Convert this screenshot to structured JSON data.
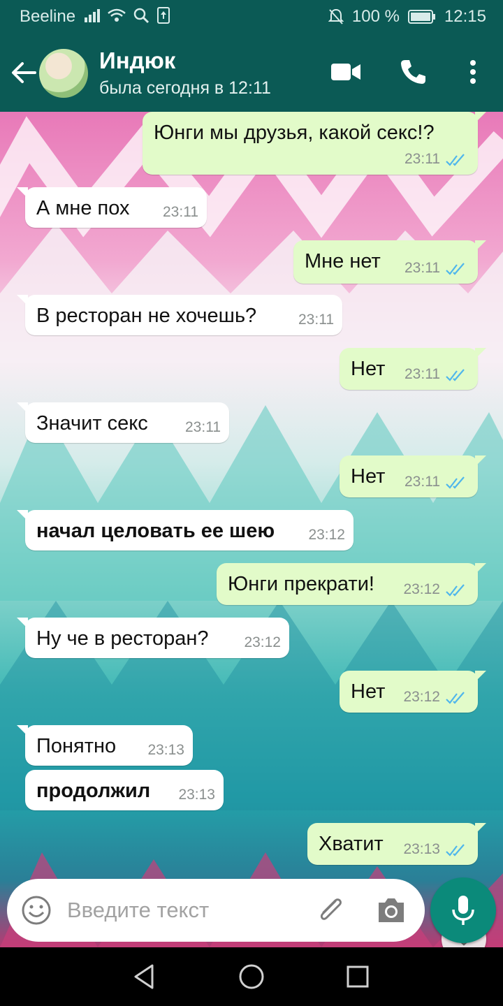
{
  "status_bar": {
    "carrier": "Beeline",
    "battery": "100 %",
    "time": "12:15"
  },
  "header": {
    "contact_name": "Индюк",
    "last_seen": "была сегодня в 12:11"
  },
  "messages": [
    {
      "dir": "out",
      "text": "Юнги мы друзья, какой секс!?",
      "time": "23:11",
      "bold": false
    },
    {
      "dir": "in",
      "text": "А мне пох",
      "time": "23:11",
      "bold": false
    },
    {
      "dir": "out",
      "text": "Мне нет",
      "time": "23:11",
      "bold": false
    },
    {
      "dir": "in",
      "text": "В ресторан не хочешь?",
      "time": "23:11",
      "bold": false
    },
    {
      "dir": "out",
      "text": "Нет",
      "time": "23:11",
      "bold": false
    },
    {
      "dir": "in",
      "text": "Значит секс",
      "time": "23:11",
      "bold": false
    },
    {
      "dir": "out",
      "text": "Нет",
      "time": "23:11",
      "bold": false
    },
    {
      "dir": "in",
      "text": "начал целовать ее шею",
      "time": "23:12",
      "bold": true
    },
    {
      "dir": "out",
      "text": "Юнги прекрати!",
      "time": "23:12",
      "bold": false
    },
    {
      "dir": "in",
      "text": "Ну че в ресторан?",
      "time": "23:12",
      "bold": false
    },
    {
      "dir": "out",
      "text": "Нет",
      "time": "23:12",
      "bold": false
    },
    {
      "dir": "in",
      "text": "Понятно",
      "time": "23:13",
      "bold": false
    },
    {
      "dir": "in",
      "text": "продолжил",
      "time": "23:13",
      "bold": true
    },
    {
      "dir": "out",
      "text": "Хватит",
      "time": "23:13",
      "bold": false
    }
  ],
  "composer": {
    "placeholder": "Введите текст"
  },
  "colors": {
    "header": "#0b5a55",
    "bubble_out": "#e2fbc9",
    "bubble_in": "#ffffff",
    "ticks": "#4fb6ec",
    "mic": "#0b8a7a"
  },
  "icons": [
    "back-arrow-icon",
    "video-call-icon",
    "phone-icon",
    "more-vert-icon",
    "emoji-icon",
    "attach-icon",
    "camera-icon",
    "mic-icon",
    "scroll-down-icon",
    "nav-back-icon",
    "nav-home-icon",
    "nav-recents-icon"
  ]
}
